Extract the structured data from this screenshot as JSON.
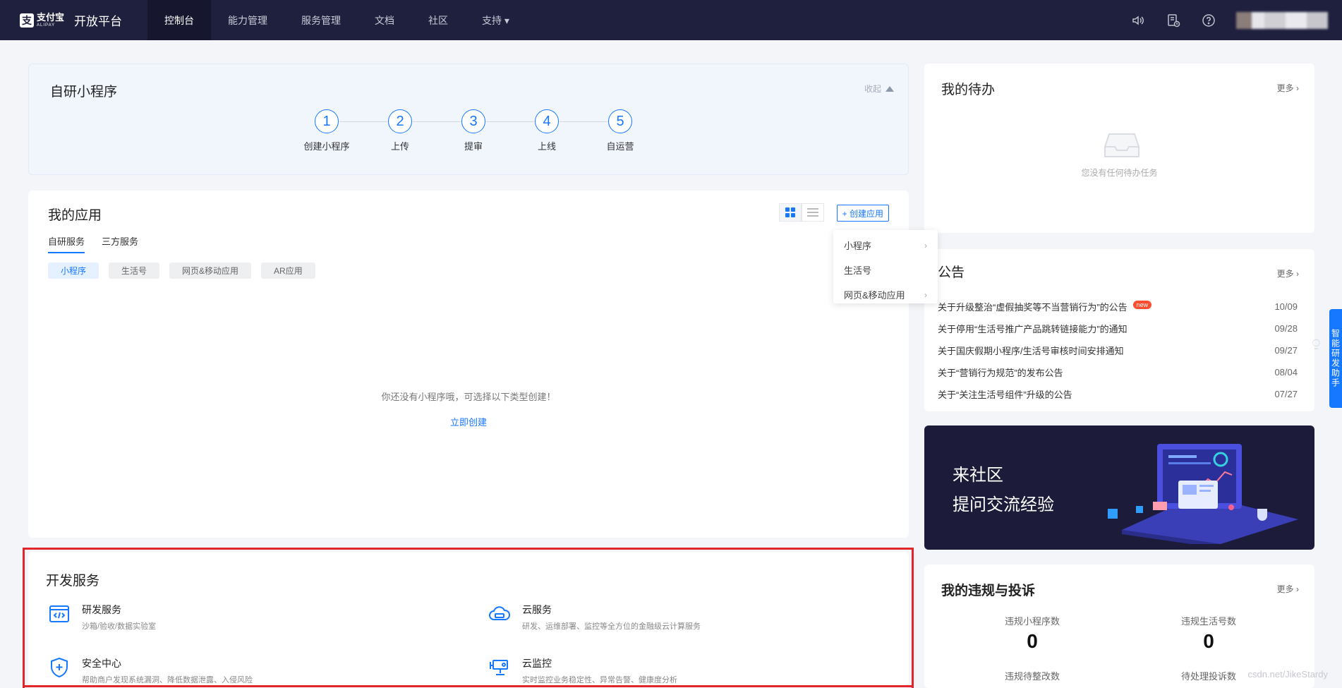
{
  "nav": {
    "brand_cn": "支付宝",
    "brand_en": "ALIPAY",
    "platform": "开放平台",
    "items": [
      {
        "label": "控制台"
      },
      {
        "label": "能力管理"
      },
      {
        "label": "服务管理"
      },
      {
        "label": "文档"
      },
      {
        "label": "社区"
      },
      {
        "label": "支持 ▾"
      }
    ],
    "icons": [
      "speaker-icon",
      "document-clock-icon",
      "help-icon"
    ]
  },
  "mini_program": {
    "title": "自研小程序",
    "collapse_label": "收起",
    "steps": [
      {
        "num": "1",
        "label": "创建小程序"
      },
      {
        "num": "2",
        "label": "上传"
      },
      {
        "num": "3",
        "label": "提审"
      },
      {
        "num": "4",
        "label": "上线"
      },
      {
        "num": "5",
        "label": "自运营"
      }
    ]
  },
  "my_apps": {
    "title": "我的应用",
    "tabs": [
      {
        "label": "自研服务"
      },
      {
        "label": "三方服务"
      }
    ],
    "chips": [
      {
        "label": "小程序"
      },
      {
        "label": "生活号"
      },
      {
        "label": "网页&移动应用"
      },
      {
        "label": "AR应用"
      }
    ],
    "create_label": "+ 创建应用",
    "empty_text": "你还没有小程序哦，可选择以下类型创建！",
    "empty_link": "立即创建",
    "dropdown": [
      {
        "label": "小程序",
        "arrow": "›"
      },
      {
        "label": "生活号",
        "arrow": ""
      },
      {
        "label": "网页&移动应用",
        "arrow": "›"
      }
    ]
  },
  "dev_services": {
    "title": "开发服务",
    "items": [
      {
        "name": "研发服务",
        "desc": "沙箱/验收/数据实验室",
        "icon": "code-window-icon"
      },
      {
        "name": "云服务",
        "desc": "研发、运维部署、监控等全方位的金融级云计算服务",
        "icon": "cloud-icon"
      },
      {
        "name": "安全中心",
        "desc": "帮助商户发现系统漏洞、降低数据泄露、入侵风险",
        "icon": "shield-plus-icon"
      },
      {
        "name": "云监控",
        "desc": "实时监控业务稳定性、异常告警、健康度分析",
        "icon": "camera-monitor-icon"
      }
    ]
  },
  "todo": {
    "title": "我的待办",
    "more": "更多 ›",
    "empty_text": "您没有任何待办任务"
  },
  "notices": {
    "title": "公告",
    "more": "更多 ›",
    "new_badge": "new",
    "items": [
      {
        "text": "关于升级整治“虚假抽奖等不当营销行为”的公告",
        "date": "10/09",
        "is_new": true
      },
      {
        "text": "关于停用“生活号推广产品跳转链接能力”的通知",
        "date": "09/28"
      },
      {
        "text": "关于国庆假期小程序/生活号审核时间安排通知",
        "date": "09/27"
      },
      {
        "text": "关于“营销行为规范”的发布公告",
        "date": "08/04"
      },
      {
        "text": "关于“关注生活号组件”升级的公告",
        "date": "07/27"
      }
    ]
  },
  "community": {
    "line1": "来社区",
    "line2": "提问交流经验"
  },
  "violations": {
    "title": "我的违规与投诉",
    "more": "更多 ›",
    "stats": [
      {
        "label": "违规小程序数",
        "value": "0"
      },
      {
        "label": "违规生活号数",
        "value": "0"
      },
      {
        "label": "违规待整改数",
        "value": ""
      },
      {
        "label": "待处理投诉数",
        "value": ""
      }
    ]
  },
  "assistant_label": "智能研发助手",
  "watermark": "csdn.net/JikeStardy",
  "colors": {
    "nav_bg": "#1f1f3e",
    "accent": "#1677ff",
    "highlight_frame": "#e0252b",
    "new_badge": "#ff4d2d"
  }
}
